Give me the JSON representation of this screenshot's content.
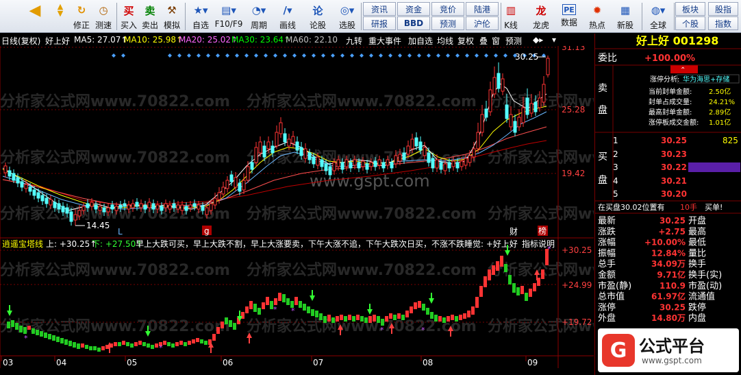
{
  "toolbar": {
    "left_buttons": [
      {
        "label": "",
        "icon": "back-arrow-icon"
      },
      {
        "label": "",
        "icon": "scroll-up-down-icon"
      },
      {
        "label": "修正",
        "icon": "fix-icon"
      },
      {
        "label": "测速",
        "icon": "speed-test-icon"
      },
      {
        "label": "买入",
        "icon": "buy-icon"
      },
      {
        "label": "卖出",
        "icon": "sell-icon"
      },
      {
        "label": "模拟",
        "icon": "hammer-icon"
      },
      {
        "label": "自选",
        "icon": "favorites-icon"
      },
      {
        "label": "F10/F9",
        "icon": "f10-icon"
      },
      {
        "label": "周期",
        "icon": "period-icon"
      },
      {
        "label": "画线",
        "icon": "draw-line-icon"
      },
      {
        "label": "论股",
        "icon": "discuss-icon"
      },
      {
        "label": "选股",
        "icon": "stock-pick-icon"
      }
    ],
    "grid_buttons": [
      "资讯",
      "资金",
      "竞价",
      "陆港",
      "研报",
      "BBD",
      "预测",
      "沪伦"
    ],
    "right_buttons": [
      {
        "label": "K线",
        "icon": "kline-icon"
      },
      {
        "label": "龙虎",
        "icon": "dragon-tiger-icon"
      },
      {
        "label": "数据",
        "icon": "pe-data-icon"
      },
      {
        "label": "热点",
        "icon": "hotspot-icon"
      },
      {
        "label": "新股",
        "icon": "new-stock-icon"
      },
      {
        "label": "全球",
        "icon": "globe-icon"
      }
    ],
    "far_right_buttons": [
      "板块",
      "股指",
      "个股",
      "指数"
    ]
  },
  "chart_header": {
    "mode": "日线(复权)",
    "stock_name": "好上好",
    "ma5": "MA5: 27.07↑",
    "ma10": "MA10: 25.98↑",
    "ma20": "MA20: 25.02↑",
    "ma30": "MA30: 23.64↑",
    "ma60": "MA60: 22.10",
    "tools": [
      "九转",
      "重大事件",
      "加自选",
      "均线",
      "复权",
      "叠",
      "窗",
      "预测"
    ],
    "nav_right": "◆▸",
    "nav_down": "▾"
  },
  "right_panel": {
    "title": "好上好 001298",
    "weibi_label": "委比",
    "weibi_value": "+100.00%",
    "sell_label": "卖盘",
    "buy_label": "买盘",
    "limit_up": {
      "title": "涨停分析:",
      "tags": "华为海思+存储",
      "rows": [
        {
          "label": "当前封单金额:",
          "value": "2.50亿"
        },
        {
          "label": "封单占成交量:",
          "value": "24.21%"
        },
        {
          "label": "最高封单金额:",
          "value": "2.89亿"
        },
        {
          "label": "涨停板成交金额:",
          "value": "1.01亿"
        }
      ]
    },
    "buy_orders": [
      {
        "level": "1",
        "price": "30.25",
        "volume": "825"
      },
      {
        "level": "2",
        "price": "30.23",
        "volume": ""
      },
      {
        "level": "3",
        "price": "30.22",
        "volume": ""
      },
      {
        "level": "4",
        "price": "30.21",
        "volume": ""
      },
      {
        "level": "5",
        "price": "30.20",
        "volume": ""
      }
    ],
    "buy_position_text": "在买盘30.02位置有",
    "buy_position_volume": "10手",
    "buy_action": "买单!",
    "stats": [
      {
        "l1": "最新",
        "v1": "30.25",
        "l2": "开盘",
        "v2": ""
      },
      {
        "l1": "涨跌",
        "v1": "+2.75",
        "l2": "最高",
        "v2": ""
      },
      {
        "l1": "涨幅",
        "v1": "+10.00%",
        "l2": "最低",
        "v2": ""
      },
      {
        "l1": "振幅",
        "v1": "12.84%",
        "l2": "量比",
        "v2": ""
      },
      {
        "l1": "总手",
        "v1": "34.09万",
        "l2": "换手",
        "v2": ""
      },
      {
        "l1": "金额",
        "v1": "9.71亿",
        "l2": "换手(实)",
        "v2": ""
      },
      {
        "l1": "市盈(静)",
        "v1": "110.9",
        "l2": "市盈(动)",
        "v2": ""
      },
      {
        "l1": "总市值",
        "v1": "61.97亿",
        "l2": "流通值",
        "v2": ""
      },
      {
        "l1": "涨停",
        "v1": "30.25",
        "l2": "跌停",
        "v2": ""
      },
      {
        "l1": "外盘",
        "v1": "14.80万",
        "l2": "内盘",
        "v2": ""
      }
    ]
  },
  "main_chart": {
    "axis_labels": [
      "31.13",
      "25.28",
      "19.42"
    ],
    "high_label": "30.25",
    "low_label": "14.45",
    "markers": [
      "L",
      "g",
      "财",
      "榜"
    ]
  },
  "indicator": {
    "name": "逍遥宝塔线",
    "up": "上: +30.25↑",
    "down": "下: +27.50↑",
    "description": "早上大跌可买，早上大跌不割，早上大涨要卖，下午大涨不追，下午大跌次日买，不涨不跌睡觉: +好上好",
    "help": "指标说明",
    "axis_labels": [
      "+30.25",
      "+24.99",
      "+19.72"
    ]
  },
  "date_axis": [
    "03",
    "04",
    "05",
    "06",
    "07",
    "08",
    "09"
  ],
  "watermarks": [
    "分析家公式网www.70822.com",
    "www.gspt.com"
  ],
  "logo": {
    "name": "公式平台",
    "url": "www.gspt.com"
  },
  "colors": {
    "up": "#ff3333",
    "down": "#54ffff",
    "ma5": "#ffffff",
    "ma10": "#ffff00",
    "ma20": "#ff66ff",
    "ma30": "#00ff00",
    "ma60": "#c0c0c0",
    "accent": "#ffff00",
    "arrow_up": "#ff4040",
    "arrow_down": "#33ff33",
    "star": "#cc55ff"
  }
}
